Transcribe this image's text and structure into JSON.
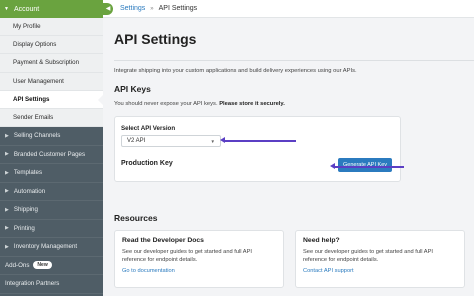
{
  "sidebar": {
    "account_label": "Account",
    "sub_items": [
      {
        "label": "My Profile",
        "active": false
      },
      {
        "label": "Display Options",
        "active": false
      },
      {
        "label": "Payment & Subscription",
        "active": false
      },
      {
        "label": "User Management",
        "active": false
      },
      {
        "label": "API Settings",
        "active": true
      },
      {
        "label": "Sender Emails",
        "active": false
      }
    ],
    "nav_items": [
      {
        "label": "Selling Channels"
      },
      {
        "label": "Branded Customer Pages"
      },
      {
        "label": "Templates"
      },
      {
        "label": "Automation"
      },
      {
        "label": "Shipping"
      },
      {
        "label": "Printing"
      },
      {
        "label": "Inventory Management"
      }
    ],
    "addons_label": "Add-Ons",
    "addons_badge": "New",
    "integration_label": "Integration Partners"
  },
  "breadcrumb": {
    "parent": "Settings",
    "separator": "»",
    "current": "API Settings"
  },
  "page": {
    "title": "API Settings",
    "intro": "Integrate shipping into your custom applications and build delivery experiences using our APIs."
  },
  "api_keys": {
    "title": "API Keys",
    "warning_prefix": "You should never expose your API keys.",
    "warning_bold": "Please store it securely.",
    "version_label": "Select API Version",
    "version_value": "V2 API",
    "production_key_label": "Production Key",
    "generate_button": "Generate API Key"
  },
  "resources": {
    "title": "Resources",
    "cards": [
      {
        "title": "Read the Developer Docs",
        "desc": "See our developer guides to get started and full API reference for endpoint details.",
        "link": "Go to documentation"
      },
      {
        "title": "Need help?",
        "desc": "See our developer guides to get started and full API reference for endpoint details.",
        "link": "Contact API support"
      }
    ]
  },
  "colors": {
    "sidebar_bg": "#4f5d66",
    "account_green": "#6aa33f",
    "link_blue": "#2b7bbf",
    "arrow_purple": "#5b3fc4"
  }
}
